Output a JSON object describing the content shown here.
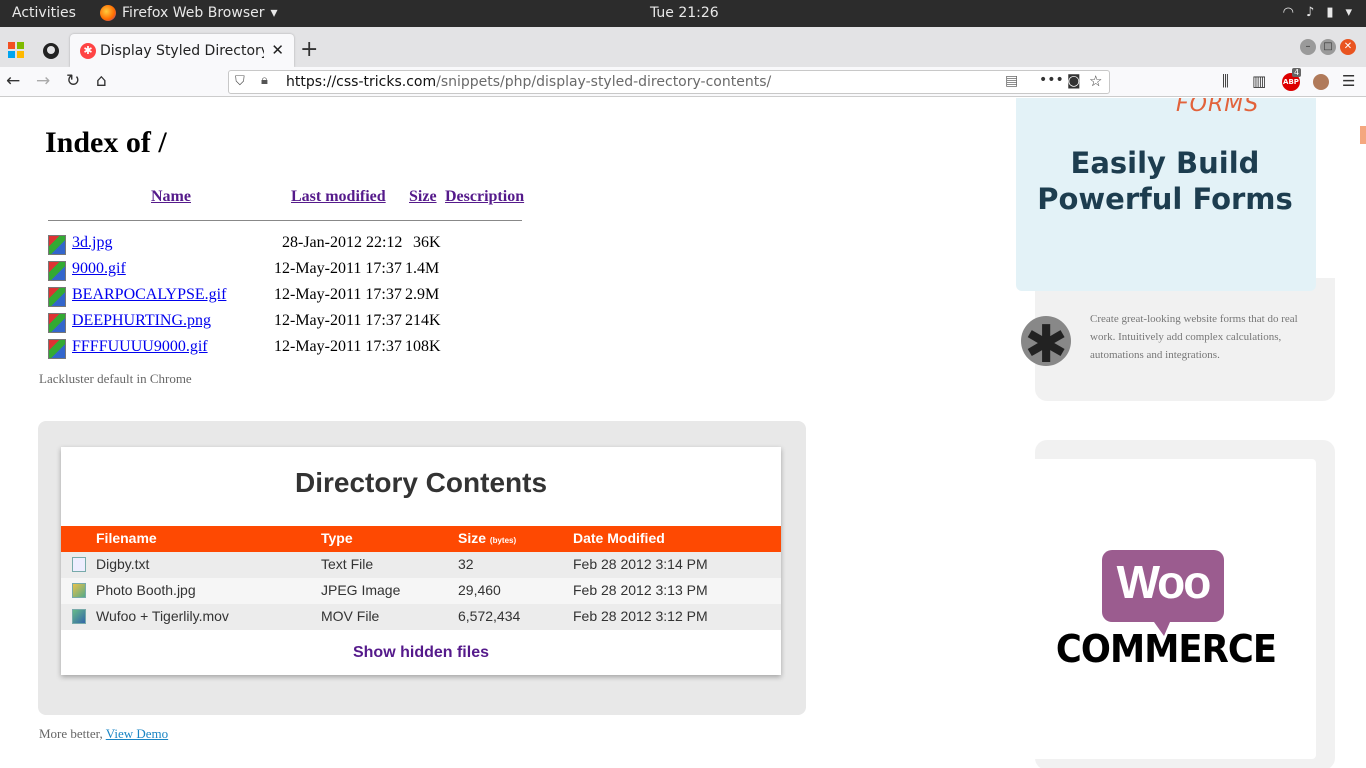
{
  "system": {
    "activities": "Activities",
    "app_name": "Firefox Web Browser",
    "clock": "Tue 21:26"
  },
  "browser": {
    "tab_title": "Display Styled Directory Contents",
    "url_host": "https://css-tricks.com",
    "url_path": "/snippets/php/display-styled-directory-contents/",
    "abp_badge": "ABP",
    "abp_count": "4"
  },
  "index_listing": {
    "title": "Index of /",
    "headers": {
      "name": "Name",
      "last_modified": "Last modified",
      "size": "Size",
      "description": "Description"
    },
    "rows": [
      {
        "name": "3d.jpg",
        "date": "28-Jan-2012 22:12",
        "size": "36K"
      },
      {
        "name": "9000.gif",
        "date": "12-May-2011 17:37",
        "size": "1.4M"
      },
      {
        "name": "BEARPOCALYPSE.gif",
        "date": "12-May-2011 17:37",
        "size": "2.9M"
      },
      {
        "name": "DEEPHURTING.png",
        "date": "12-May-2011 17:37",
        "size": "214K"
      },
      {
        "name": "FFFFUUUU9000.gif",
        "date": "12-May-2011 17:37",
        "size": "108K"
      }
    ],
    "caption": "Lackluster default in Chrome"
  },
  "styled_listing": {
    "title": "Directory Contents",
    "headers": {
      "filename": "Filename",
      "type": "Type",
      "size": "Size",
      "size_unit": "(bytes)",
      "date": "Date Modified"
    },
    "rows": [
      {
        "filename": "Digby.txt",
        "type": "Text File",
        "size": "32",
        "date": "Feb 28 2012 3:14 PM"
      },
      {
        "filename": "Photo Booth.jpg",
        "type": "JPEG Image",
        "size": "29,460",
        "date": "Feb 28 2012 3:13 PM"
      },
      {
        "filename": "Wufoo + Tigerlily.mov",
        "type": "MOV File",
        "size": "6,572,434",
        "date": "Feb 28 2012 3:12 PM"
      }
    ],
    "show_hidden": "Show hidden files",
    "caption_prefix": "More better,",
    "caption_link": "View Demo"
  },
  "ads": {
    "forms_logo": "FORMS",
    "headline_line1": "Easily Build",
    "headline_line2": "Powerful Forms",
    "asterisk": "✱",
    "description": "Create great-looking website forms that do real work. Intuitively add complex calculations, automations and integrations.",
    "woo_top": "Woo",
    "woo_bottom": "COMMERCE"
  },
  "colors": {
    "accent_orange": "#fe4902",
    "woo_purple": "#9b5c8f",
    "link_blue": "#0000ee",
    "visited_purple": "#551a8b"
  }
}
